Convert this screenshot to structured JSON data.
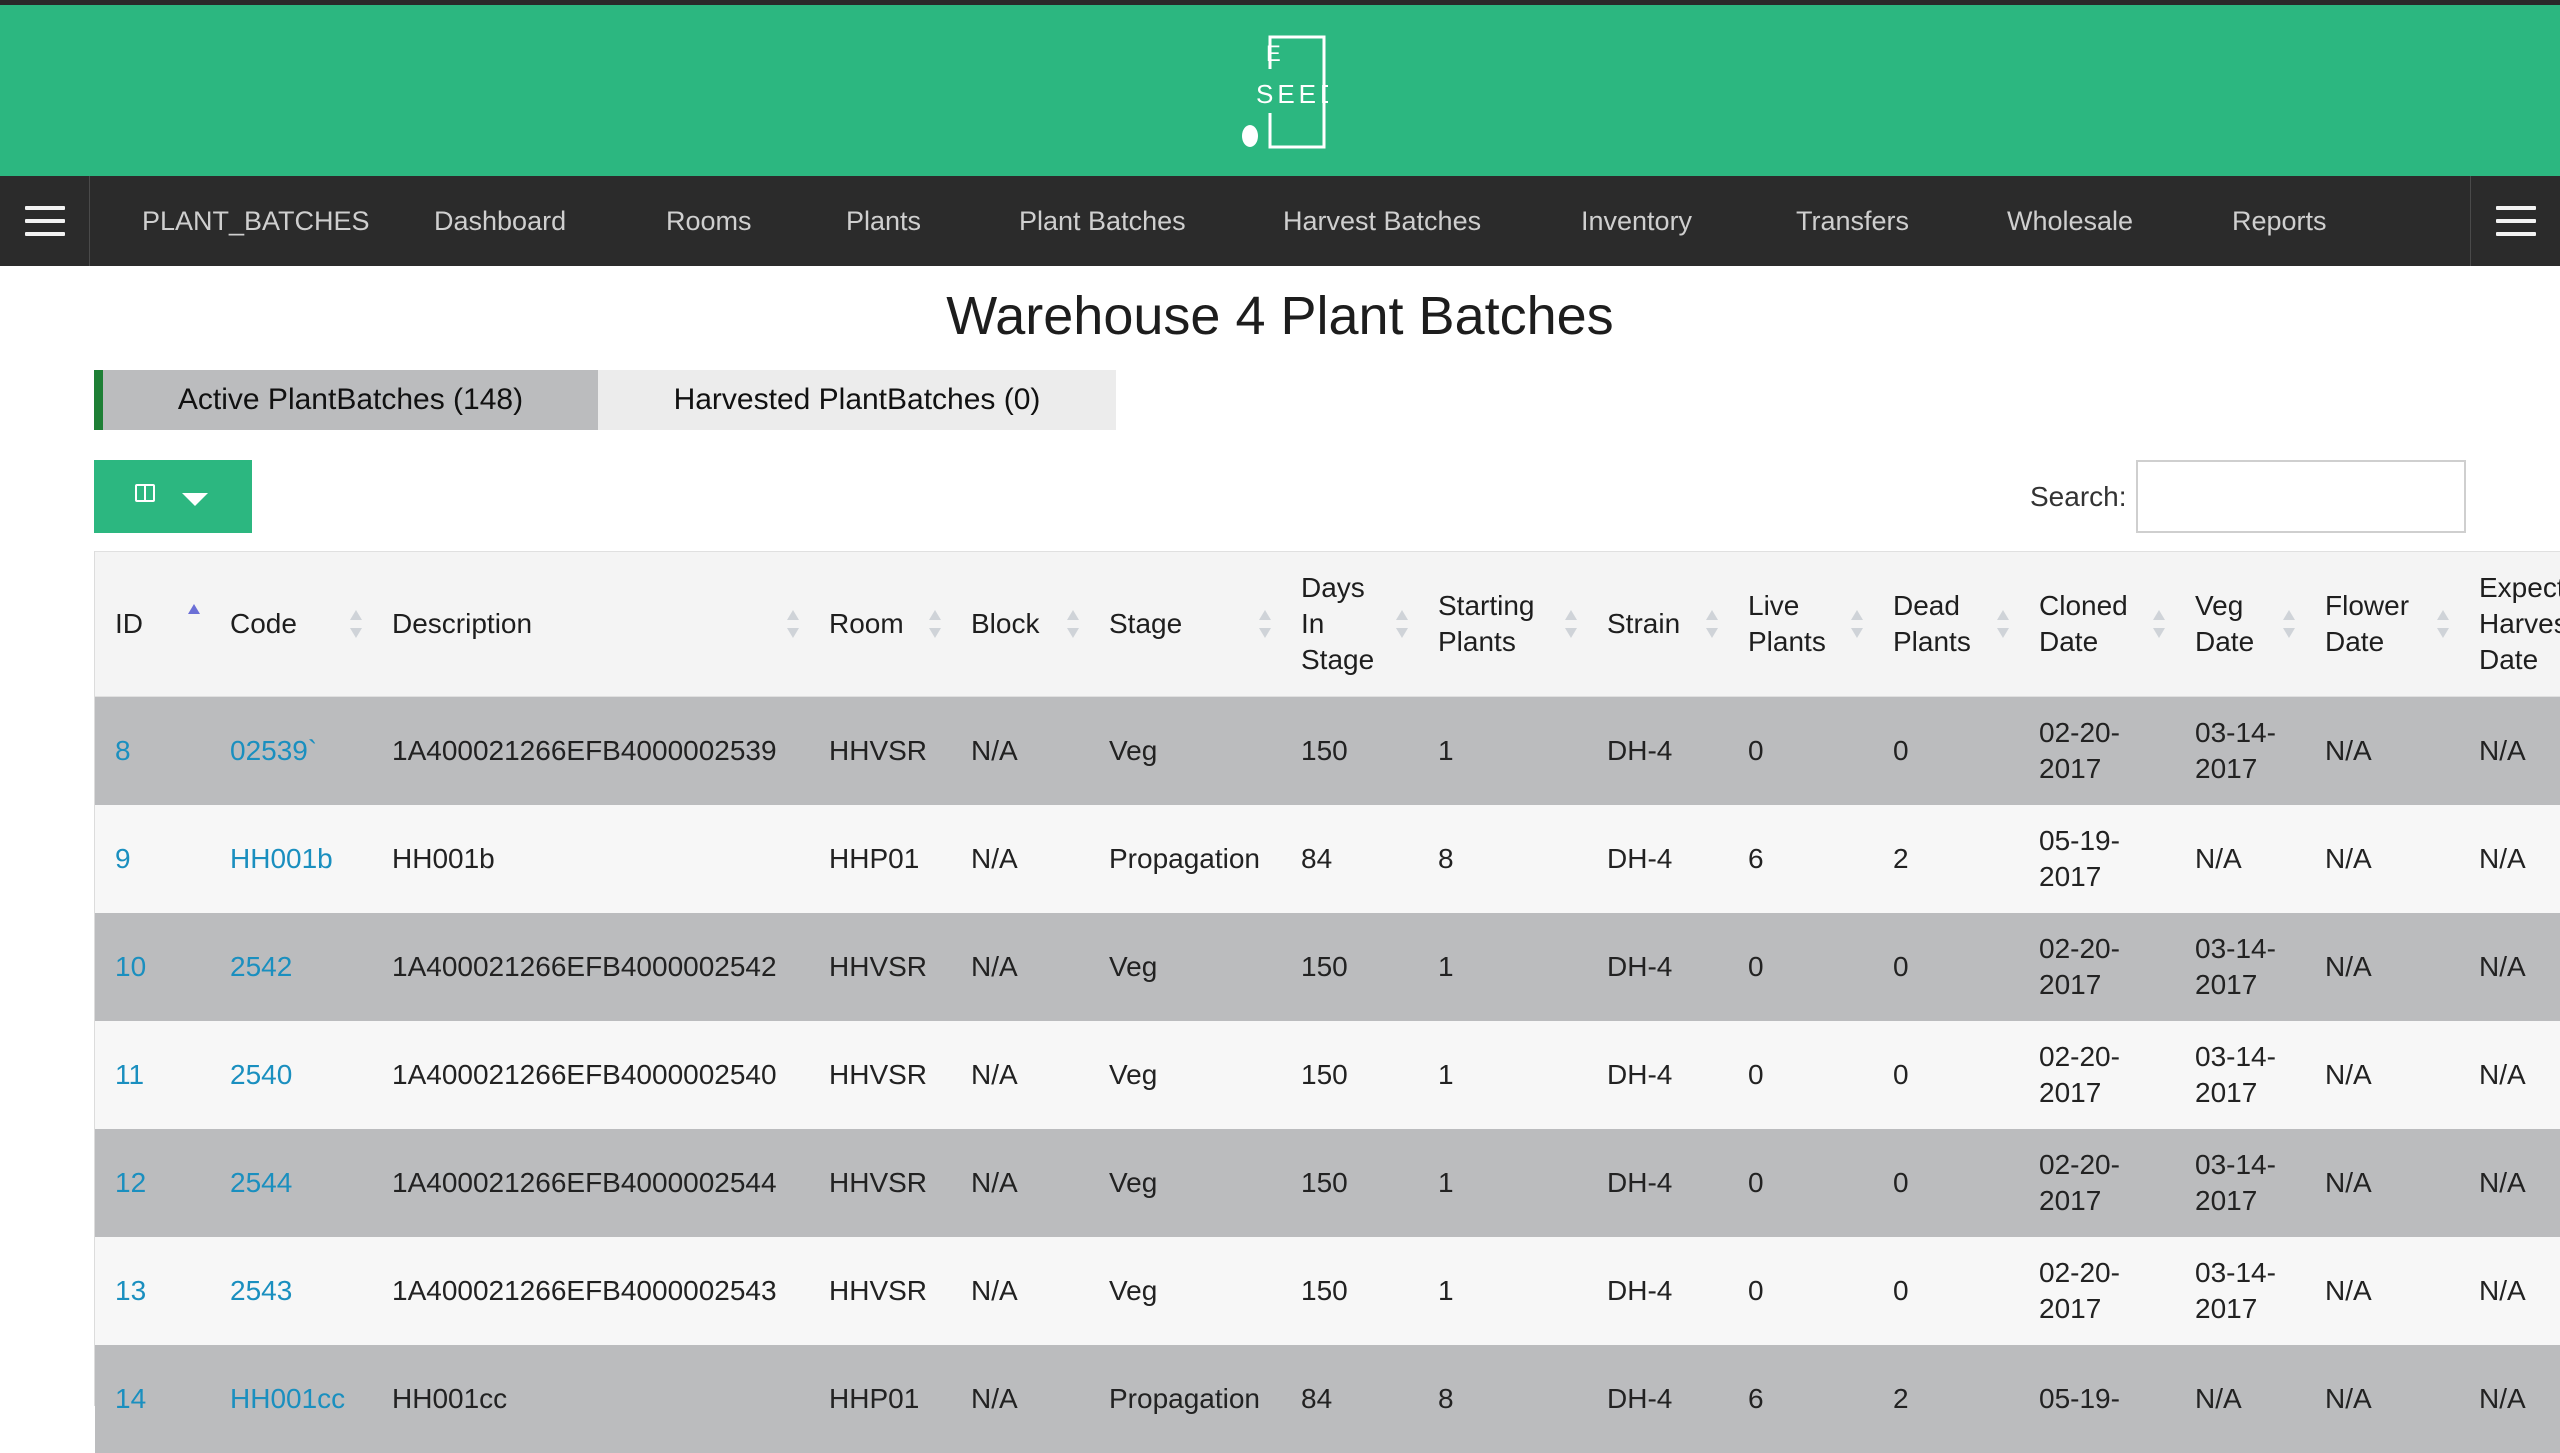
{
  "app": {
    "logo_text_top": "E",
    "logo_text_bottom": "SEED"
  },
  "colors": {
    "brand_green": "#2cb780",
    "nav_bg": "#2b2b2b",
    "link": "#1a8fbf",
    "active_tab_accent": "#1e7f35"
  },
  "nav": {
    "items": [
      {
        "label": "PLANT_BATCHES"
      },
      {
        "label": "Dashboard"
      },
      {
        "label": "Rooms"
      },
      {
        "label": "Plants"
      },
      {
        "label": "Plant Batches"
      },
      {
        "label": "Harvest Batches"
      },
      {
        "label": "Inventory"
      },
      {
        "label": "Transfers"
      },
      {
        "label": "Wholesale"
      },
      {
        "label": "Reports"
      }
    ],
    "left_icon": "hamburger-menu-icon",
    "right_icon": "hamburger-menu-icon"
  },
  "page": {
    "title": "Warehouse 4 Plant Batches"
  },
  "tabs": [
    {
      "label": "Active PlantBatches (148)",
      "active": true
    },
    {
      "label": "Harvested PlantBatches (0)",
      "active": false
    }
  ],
  "toolbar": {
    "columns_icon": "columns-icon",
    "dropdown_icon": "caret-down-icon"
  },
  "search": {
    "label": "Search:",
    "value": ""
  },
  "table": {
    "columns": [
      {
        "label": "ID",
        "sort": "asc"
      },
      {
        "label": "Code",
        "sort": "none"
      },
      {
        "label": "Description",
        "sort": "none"
      },
      {
        "label": "Room",
        "sort": "none"
      },
      {
        "label": "Block",
        "sort": "none"
      },
      {
        "label": "Stage",
        "sort": "none"
      },
      {
        "label": "Days In Stage",
        "sort": "none"
      },
      {
        "label": "Starting Plants",
        "sort": "none"
      },
      {
        "label": "Strain",
        "sort": "none"
      },
      {
        "label": "Live Plants",
        "sort": "none"
      },
      {
        "label": "Dead Plants",
        "sort": "none"
      },
      {
        "label": "Cloned Date",
        "sort": "none"
      },
      {
        "label": "Veg Date",
        "sort": "none"
      },
      {
        "label": "Flower Date",
        "sort": "none"
      },
      {
        "label": "Expected Harvest Date",
        "sort": "none"
      }
    ],
    "rows": [
      [
        "8",
        "02539`",
        "1A400021266EFB4000002539",
        "HHVSR",
        "N/A",
        "Veg",
        "150",
        "1",
        "DH-4",
        "0",
        "0",
        "02-20-2017",
        "03-14-2017",
        "N/A",
        "N/A"
      ],
      [
        "9",
        "HH001b",
        "HH001b",
        "HHP01",
        "N/A",
        "Propagation",
        "84",
        "8",
        "DH-4",
        "6",
        "2",
        "05-19-2017",
        "N/A",
        "N/A",
        "N/A"
      ],
      [
        "10",
        "2542",
        "1A400021266EFB4000002542",
        "HHVSR",
        "N/A",
        "Veg",
        "150",
        "1",
        "DH-4",
        "0",
        "0",
        "02-20-2017",
        "03-14-2017",
        "N/A",
        "N/A"
      ],
      [
        "11",
        "2540",
        "1A400021266EFB4000002540",
        "HHVSR",
        "N/A",
        "Veg",
        "150",
        "1",
        "DH-4",
        "0",
        "0",
        "02-20-2017",
        "03-14-2017",
        "N/A",
        "N/A"
      ],
      [
        "12",
        "2544",
        "1A400021266EFB4000002544",
        "HHVSR",
        "N/A",
        "Veg",
        "150",
        "1",
        "DH-4",
        "0",
        "0",
        "02-20-2017",
        "03-14-2017",
        "N/A",
        "N/A"
      ],
      [
        "13",
        "2543",
        "1A400021266EFB4000002543",
        "HHVSR",
        "N/A",
        "Veg",
        "150",
        "1",
        "DH-4",
        "0",
        "0",
        "02-20-2017",
        "03-14-2017",
        "N/A",
        "N/A"
      ],
      [
        "14",
        "HH001cc",
        "HH001cc",
        "HHP01",
        "N/A",
        "Propagation",
        "84",
        "8",
        "DH-4",
        "6",
        "2",
        "05-19-",
        "N/A",
        "N/A",
        "N/A"
      ]
    ]
  }
}
